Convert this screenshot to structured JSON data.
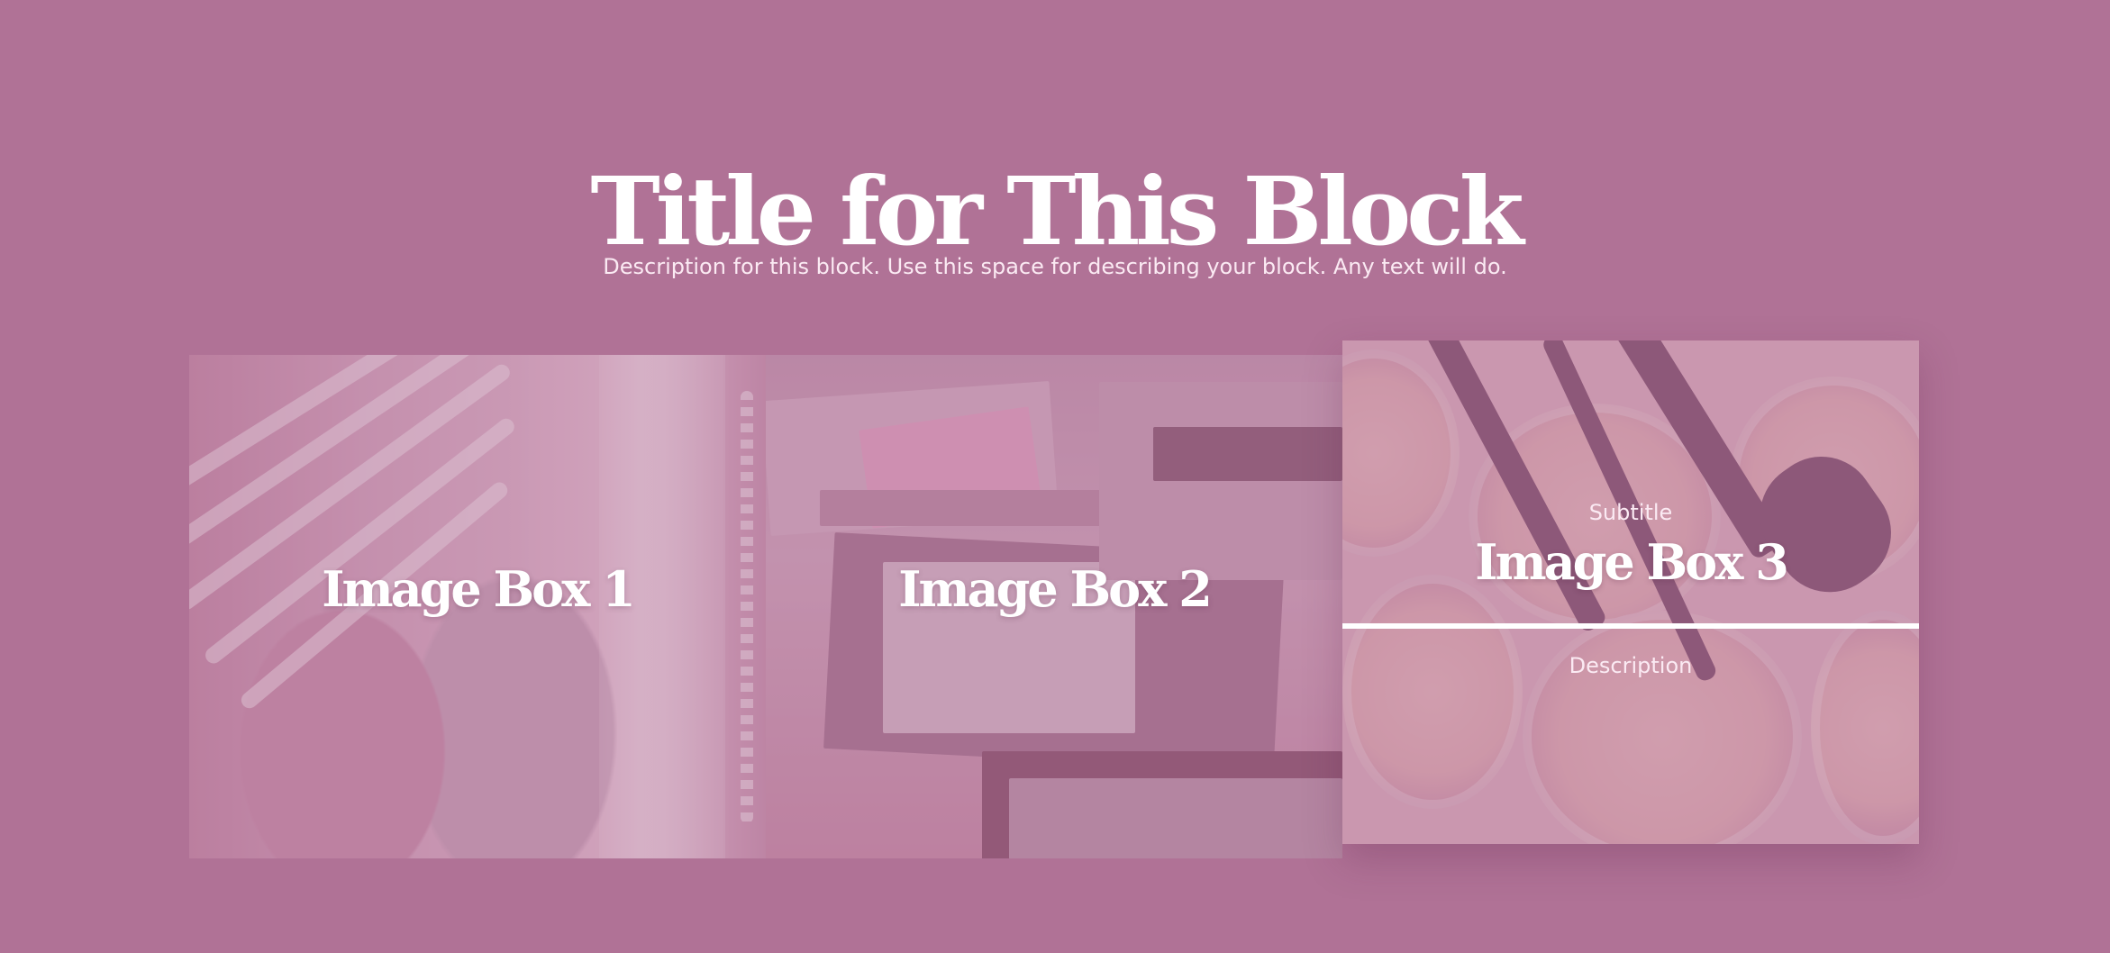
{
  "header": {
    "title": "Title for This Block",
    "description": "Description for this block. Use this space for describing your block. Any text will do."
  },
  "boxes": [
    {
      "title": "Image Box 1"
    },
    {
      "title": "Image Box 2"
    },
    {
      "title": "Image Box 3",
      "subtitle": "Subtitle",
      "description": "Description"
    }
  ],
  "colors": {
    "background": "#b07296",
    "text": "#ffffff",
    "overlay": "#b07296"
  }
}
